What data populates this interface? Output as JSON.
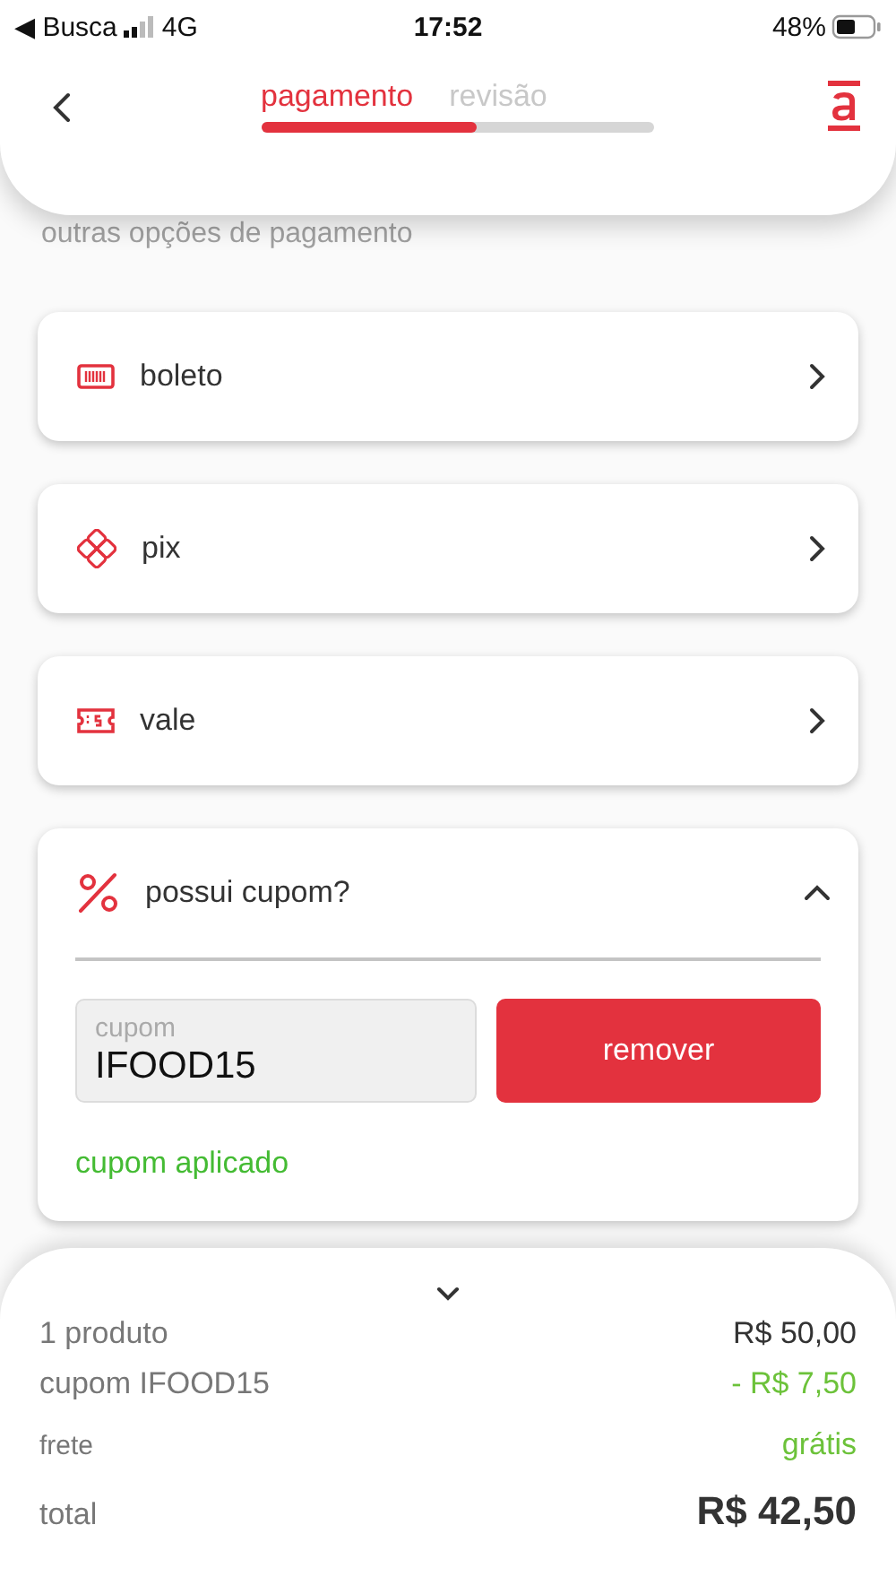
{
  "status_bar": {
    "back_app": "◀ Busca",
    "network": "4G",
    "time": "17:52",
    "battery": "48%"
  },
  "header": {
    "steps": [
      {
        "label": "pagamento",
        "selected": true
      },
      {
        "label": "revisão",
        "selected": false
      }
    ],
    "progress": {
      "level": 0.55
    }
  },
  "section_title": "outras opções de pagamento",
  "payment_options": [
    {
      "kind": "boleto",
      "label": "boleto"
    },
    {
      "kind": "pix",
      "label": "pix"
    },
    {
      "kind": "vale",
      "label": "vale"
    }
  ],
  "coupon": {
    "title": "possui cupom?",
    "expanded": true,
    "field": {
      "label": "cupom",
      "value": "IFOOD15"
    },
    "button": "remover",
    "status": "cupom aplicado"
  },
  "summary": {
    "rows": [
      {
        "kind": "item",
        "label": "1 produto",
        "value": "R$ 50,00"
      },
      {
        "kind": "discount",
        "label": "cupom IFOOD15",
        "value": "- R$ 7,50"
      },
      {
        "kind": "shipping",
        "label": "frete",
        "value": "grátis"
      },
      {
        "kind": "total",
        "label": "total",
        "value": "R$ 42,50"
      }
    ]
  }
}
